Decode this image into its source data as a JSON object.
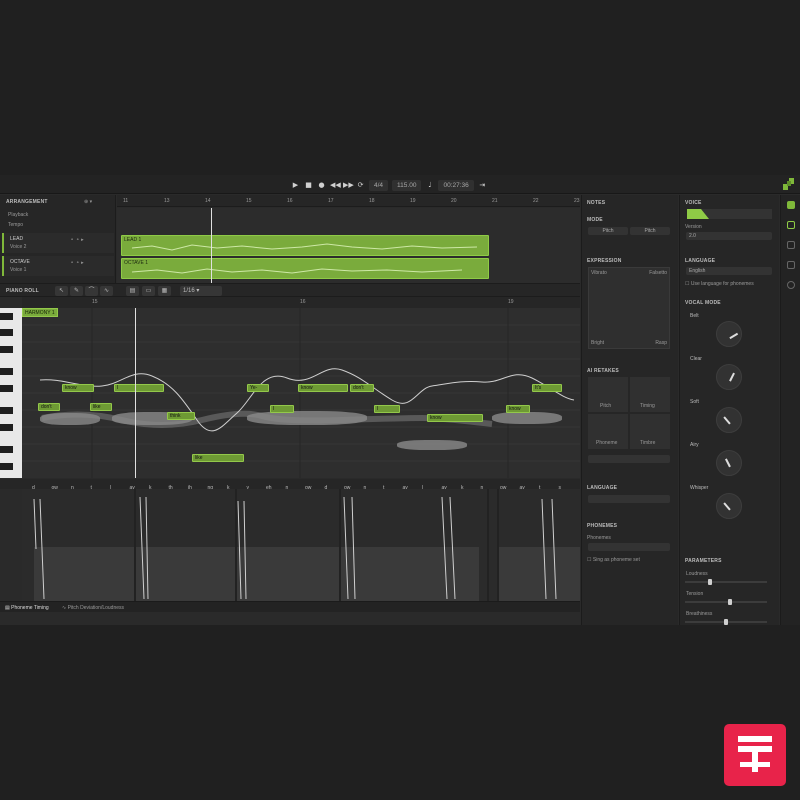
{
  "transport": {
    "time_sig": "4/4",
    "tempo": "115.00",
    "position": "00:27:36"
  },
  "arrangement": {
    "header": "ARRANGEMENT",
    "rows": [
      "Playback",
      "Tempo"
    ],
    "tracks": [
      {
        "name": "LEAD",
        "voice": "Voice 2"
      },
      {
        "name": "OCTAVE",
        "voice": "Voice 1"
      }
    ],
    "ruler": [
      "11",
      "13",
      "14",
      "15",
      "16",
      "17",
      "18",
      "19",
      "20",
      "21",
      "22",
      "23"
    ],
    "clips": [
      "LEAD 1",
      "OCTAVE 1"
    ]
  },
  "piano_roll": {
    "header": "PIANO ROLL",
    "grid": "1/16",
    "ruler": [
      "15",
      "16",
      "19"
    ],
    "region": "HARMONY 1",
    "notes": [
      {
        "text": "don't"
      },
      {
        "text": "like"
      },
      {
        "text": "think"
      },
      {
        "text": "I"
      },
      {
        "text": "Ye-"
      },
      {
        "text": "know"
      },
      {
        "text": "don't"
      },
      {
        "text": "I"
      },
      {
        "text": "like"
      },
      {
        "text": "know"
      },
      {
        "text": "I"
      },
      {
        "text": "know"
      },
      {
        "text": "It's"
      }
    ]
  },
  "phoneme": {
    "tabs": [
      "Phoneme Timing",
      "Pitch Deviation/Loudness"
    ],
    "labels": [
      "d",
      "ow",
      "n",
      "t",
      "l",
      "ay",
      "k",
      "th",
      "ih",
      "ng",
      "k",
      "y",
      "eh",
      "n",
      "ow",
      "d",
      "ow",
      "n",
      "t",
      "ay",
      "l",
      "ay",
      "k",
      "n",
      "ow",
      "ay",
      "t",
      "s"
    ]
  },
  "notes_panel": {
    "title": "NOTES",
    "mode": {
      "title": "MODE",
      "options": [
        "Pitch",
        "Pitch"
      ]
    },
    "expression": {
      "title": "EXPRESSION",
      "corners": [
        "Vibrato",
        "Falsetto",
        "Bright",
        "Rasp"
      ]
    },
    "ai_retakes": {
      "title": "AI RETAKES",
      "items": [
        "Pitch",
        "Timing",
        "Phoneme",
        "Timbre"
      ]
    },
    "language": {
      "title": "LANGUAGE"
    },
    "phonemes": {
      "title": "PHONEMES",
      "label": "Phonemes",
      "checkbox": "Sing as phoneme set"
    }
  },
  "voice_panel": {
    "title": "VOICE",
    "version_label": "Version",
    "version": "2.0",
    "language_title": "LANGUAGE",
    "language": "English",
    "lang_checkbox": "Use language for phonemes",
    "vocal_mode_title": "VOCAL MODE",
    "modes": [
      {
        "name": "Belt",
        "value": 0.72
      },
      {
        "name": "Clear",
        "value": 0.6
      },
      {
        "name": "Soft",
        "value": 0.35
      },
      {
        "name": "Airy",
        "value": 0.4
      },
      {
        "name": "Whisper",
        "value": 0.35
      }
    ],
    "parameters_title": "PARAMETERS",
    "params": [
      {
        "name": "Loudness",
        "value": 0.3
      },
      {
        "name": "Tension",
        "value": 0.55
      },
      {
        "name": "Breathiness",
        "value": 0.5
      }
    ]
  },
  "colors": {
    "accent": "#8fcb46",
    "clip": "#7aab3c",
    "badge": "#e8234a"
  }
}
